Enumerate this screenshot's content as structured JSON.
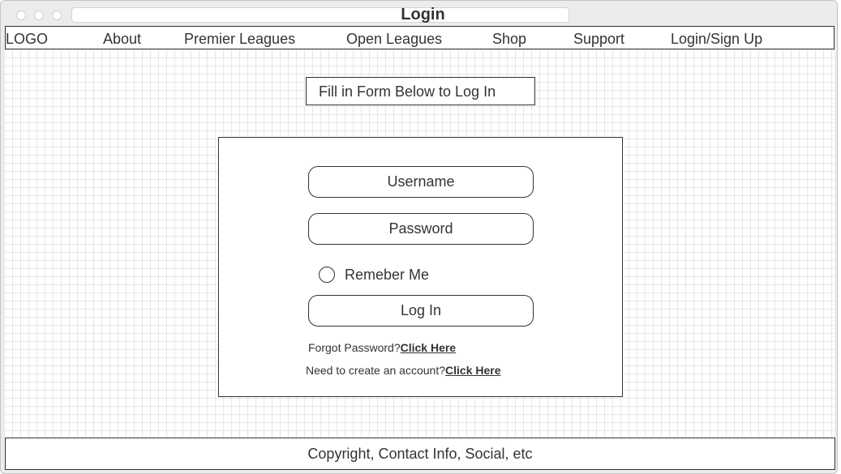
{
  "window": {
    "title": "Login"
  },
  "nav": {
    "logo": "LOGO",
    "items": [
      {
        "label": "About"
      },
      {
        "label": "Premier Leagues"
      },
      {
        "label": "Open Leagues"
      },
      {
        "label": "Shop"
      },
      {
        "label": "Support"
      },
      {
        "label": "Login/Sign Up"
      }
    ]
  },
  "form": {
    "heading": "Fill in Form Below to Log In",
    "username_placeholder": "Username",
    "password_placeholder": "Password",
    "remember_label": "Remeber Me",
    "login_button": "Log In",
    "forgot_text": "Forgot Password?",
    "forgot_link": "Click Here",
    "create_text": "Need to create an account?",
    "create_link": "Click Here"
  },
  "footer": {
    "text": "Copyright, Contact Info, Social, etc"
  }
}
